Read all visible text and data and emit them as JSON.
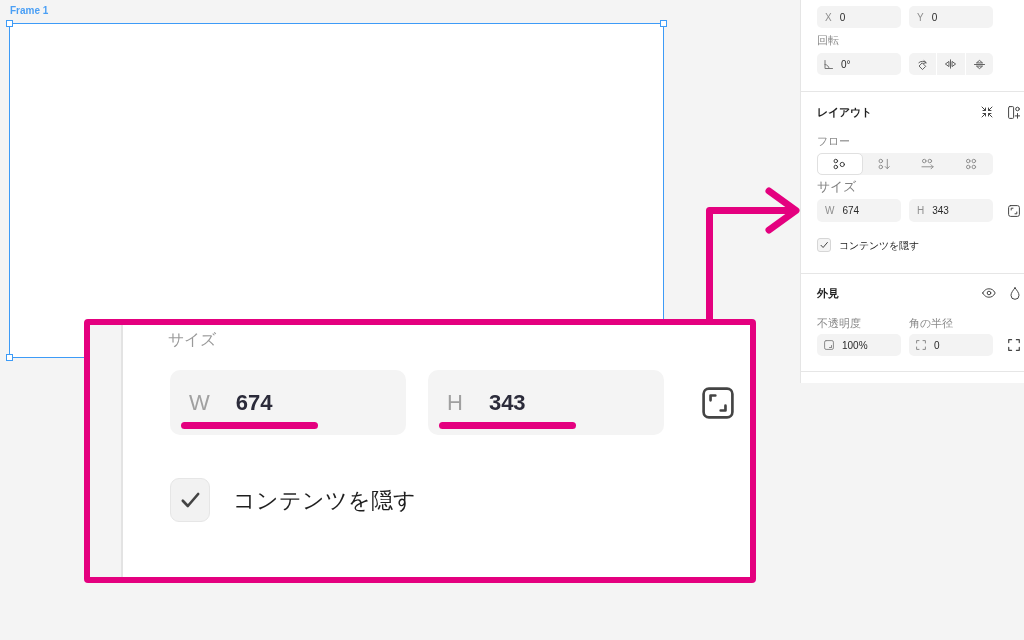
{
  "canvas": {
    "frame": {
      "label": "Frame 1",
      "selected": true
    }
  },
  "properties_panel": {
    "position": [
      {
        "label": "X",
        "value": "0"
      },
      {
        "label": "Y",
        "value": "0"
      }
    ],
    "rotation": {
      "label": "回転",
      "value": "0°"
    },
    "layout": {
      "title": "レイアウト",
      "flow": {
        "label": "フロー",
        "options": [
          {
            "selected": true
          },
          {
            "selected": false
          },
          {
            "selected": false
          },
          {
            "selected": false
          }
        ]
      },
      "size": {
        "label": "サイズ",
        "fields": [
          {
            "label": "W",
            "value": "674"
          },
          {
            "label": "H",
            "value": "343"
          }
        ]
      },
      "clip_content": {
        "label": "コンテンツを隠す",
        "checked": true
      }
    },
    "appearance": {
      "title": "外見",
      "opacity": {
        "label": "不透明度",
        "value": "100%"
      },
      "corner_radius": {
        "label": "角の半径",
        "value": "0"
      }
    }
  },
  "callout": {
    "size_label": "サイズ",
    "fields": [
      {
        "label": "W",
        "value": "674",
        "highlighted": true
      },
      {
        "label": "H",
        "value": "343",
        "highlighted": true
      }
    ],
    "clip_content": {
      "label": "コンテンツを隠す",
      "checked": true
    }
  }
}
